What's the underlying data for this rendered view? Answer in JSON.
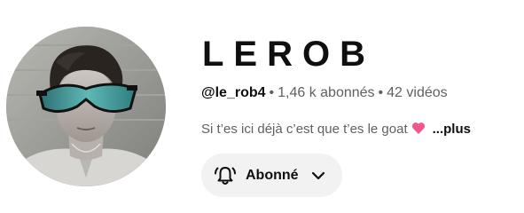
{
  "channel": {
    "name": "LEROB",
    "handle": "@le_rob4",
    "subscribers": "1,46 k abonnés",
    "videos": "42 vidéos",
    "separator": "•",
    "description": "Si t’es ici déjà c’est que t’es le goat",
    "more_label": "...plus",
    "heart_icon": "pink-heart-icon",
    "heart_color": "#f0588e"
  },
  "subscribe": {
    "label": "Abonné",
    "bell_icon": "bell-icon",
    "dropdown_icon": "chevron-down-icon"
  },
  "colors": {
    "text_primary": "#0f0f0f",
    "text_secondary": "#606060",
    "button_bg": "#f2f2f2"
  }
}
